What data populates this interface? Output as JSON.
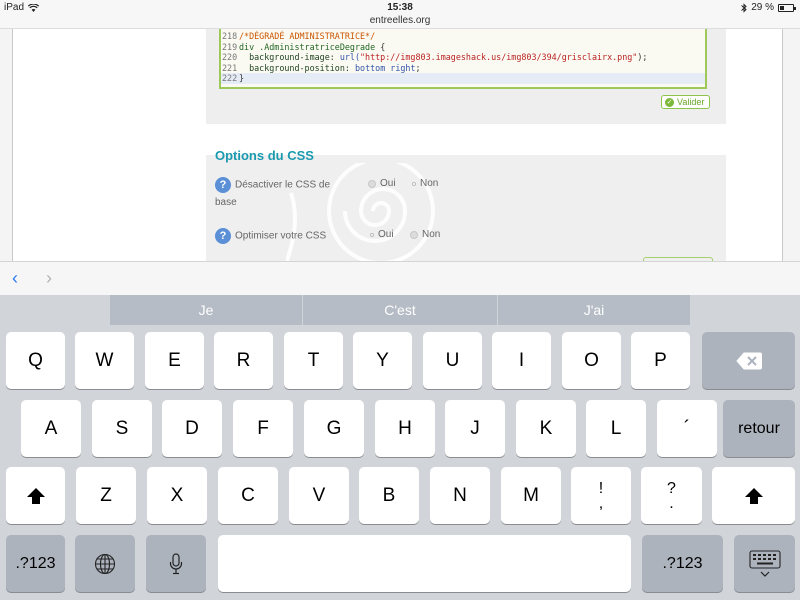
{
  "status_bar": {
    "device": "iPad",
    "time": "15:38",
    "battery": "29 %",
    "url": "entreelles.org"
  },
  "code_editor": {
    "lines": [
      {
        "num": "218",
        "parts": [
          {
            "text": "/*DÉGRADÉ ADMINISTRATRICE*/",
            "kind": "comment"
          }
        ]
      },
      {
        "num": "219",
        "parts": [
          {
            "text": "div .AdministratriceDegrade ",
            "kind": "sel"
          },
          {
            "text": "{",
            "kind": "plain"
          }
        ]
      },
      {
        "num": "220",
        "parts": [
          {
            "text": "  background-image: ",
            "kind": "prop"
          },
          {
            "text": "url(",
            "kind": "kw"
          },
          {
            "text": "\"http://img803.imageshack.us/img803/394/grisclairx.png\"",
            "kind": "str"
          },
          {
            "text": ");",
            "kind": "plain"
          }
        ]
      },
      {
        "num": "221",
        "parts": [
          {
            "text": "  background-position: ",
            "kind": "prop"
          },
          {
            "text": "bottom right",
            "kind": "kw"
          },
          {
            "text": ";",
            "kind": "plain"
          }
        ]
      },
      {
        "num": "222",
        "parts": [
          {
            "text": "}",
            "kind": "plain"
          }
        ],
        "active": true
      }
    ]
  },
  "valider_label": "Valider",
  "options_section": {
    "title": "Options du CSS",
    "help_glyph": "?",
    "option1": {
      "label_line1": "Désactiver le CSS de",
      "label_line2": "base",
      "oui": "Oui",
      "non": "Non",
      "selected": "Non"
    },
    "option2": {
      "label": "Optimiser votre CSS",
      "oui": "Oui",
      "non": "Non",
      "selected": "Oui"
    }
  },
  "nav": {
    "prev": "‹",
    "next": "›"
  },
  "keyboard": {
    "suggestions": [
      "Je",
      "C'est",
      "J'ai"
    ],
    "row1": [
      "Q",
      "W",
      "E",
      "R",
      "T",
      "Y",
      "U",
      "I",
      "O",
      "P"
    ],
    "row2": [
      "A",
      "S",
      "D",
      "F",
      "G",
      "H",
      "J",
      "K",
      "L",
      "´"
    ],
    "row3": [
      "Z",
      "X",
      "C",
      "V",
      "B",
      "N",
      "M"
    ],
    "return_label": "retour",
    "numbers_label": ".?123",
    "punct1": {
      "top": "!",
      "bottom": ","
    },
    "punct2": {
      "top": "?",
      "bottom": "."
    }
  },
  "colors": {
    "accent_blue": "#2f7cf6",
    "section_title": "#1a9ab0",
    "valider_green": "#6aa728",
    "keyboard_bg": "#d1d4d9"
  }
}
